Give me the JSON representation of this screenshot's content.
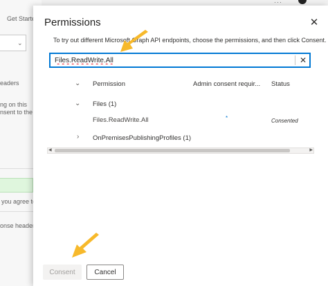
{
  "background": {
    "tab_label": "Get Starte",
    "texts": [
      "eaders",
      "ng on this",
      "nsent to the",
      "you agree to",
      "onse header"
    ]
  },
  "panel": {
    "title": "Permissions",
    "close_icon": "close-icon",
    "description": "To try out different Microsoft Graph API endpoints, choose the permissions, and then click Consent.",
    "search": {
      "value": "Files.ReadWrite.All",
      "clear_icon": "close-icon"
    },
    "table": {
      "columns": [
        "Permission",
        "Admin consent requir...",
        "Status"
      ],
      "groups": [
        {
          "label": "Files (1)",
          "expanded": true,
          "rows": [
            {
              "permission": "Files.ReadWrite.All",
              "admin_consent": "*",
              "status": "Consented"
            }
          ]
        },
        {
          "label": "OnPremisesPublishingProfiles (1)",
          "expanded": false,
          "rows": []
        }
      ]
    },
    "buttons": {
      "consent": "Consent",
      "cancel": "Cancel"
    }
  },
  "colors": {
    "accent": "#0078d4",
    "annotation_arrow": "#f7b92b"
  }
}
